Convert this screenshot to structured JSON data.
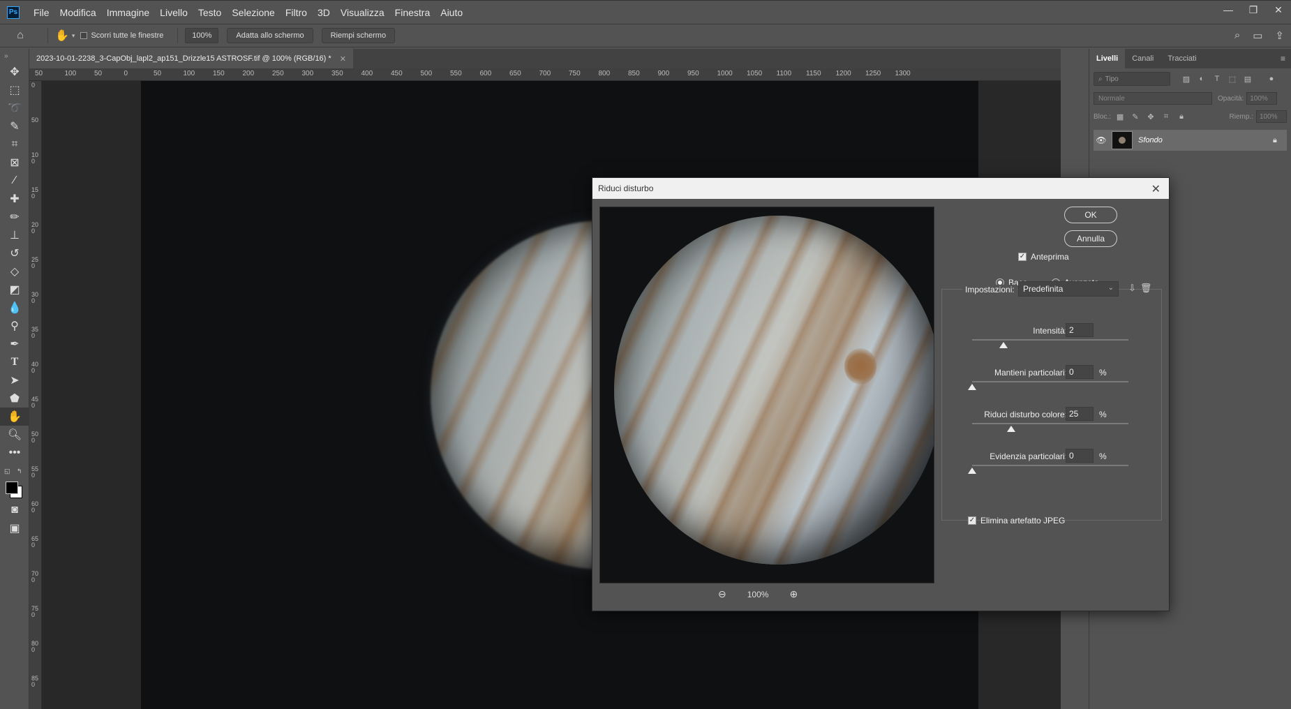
{
  "app": {
    "logo": "Ps"
  },
  "menu": [
    "File",
    "Modifica",
    "Immagine",
    "Livello",
    "Testo",
    "Selezione",
    "Filtro",
    "3D",
    "Visualizza",
    "Finestra",
    "Aiuto"
  ],
  "window_controls": [
    "—",
    "❐",
    "✕"
  ],
  "options_bar": {
    "scroll_all_label": "Scorri tutte le finestre",
    "zoom_value": "100%",
    "fit_screen_label": "Adatta allo schermo",
    "fill_screen_label": "Riempi schermo"
  },
  "document_tab": {
    "title": "2023-10-01-2238_3-CapObj_lapl2_ap151_Drizzle15 ASTROSF.tif @ 100% (RGB/16) *",
    "close": "✕"
  },
  "ruler": {
    "h_ticks": [
      "50",
      "100",
      "50",
      "0",
      "50",
      "100",
      "150",
      "200",
      "250",
      "300",
      "350",
      "400",
      "450",
      "500",
      "550",
      "600",
      "650",
      "700",
      "750",
      "800",
      "850",
      "900",
      "950",
      "1000",
      "1050",
      "1100",
      "1150",
      "1200",
      "1250",
      "1300"
    ],
    "v_ticks": [
      "0",
      "50",
      "100",
      "150",
      "200",
      "250",
      "300",
      "350",
      "400",
      "450",
      "500",
      "550",
      "600",
      "650",
      "700",
      "750",
      "800",
      "850"
    ]
  },
  "layers_panel": {
    "tabs": [
      "Livelli",
      "Canali",
      "Tracciati"
    ],
    "filter_placeholder": "Tipo",
    "blend_mode": "Normale",
    "opacity_label": "Opacità:",
    "opacity_value": "100%",
    "lock_label": "Bloc.:",
    "fill_label": "Riemp.:",
    "fill_value": "100%",
    "layer_name": "Sfondo"
  },
  "dialog": {
    "title": "Riduci disturbo",
    "ok": "OK",
    "cancel": "Annulla",
    "preview_label": "Anteprima",
    "preview_checked": true,
    "mode_base": "Base",
    "mode_advanced": "Avanzata",
    "mode_selected": "Base",
    "settings_label": "Impostazioni:",
    "settings_value": "Predefinita",
    "zoom_value": "100%",
    "params": [
      {
        "label": "Intensità:",
        "value": "2",
        "percent": "",
        "level": 0.2
      },
      {
        "label": "Mantieni particolari:",
        "value": "0",
        "percent": "%",
        "level": 0.0
      },
      {
        "label": "Riduci disturbo colore:",
        "value": "25",
        "percent": "%",
        "level": 0.25
      },
      {
        "label": "Evidenzia particolari:",
        "value": "0",
        "percent": "%",
        "level": 0.0
      }
    ],
    "jpeg_label": "Elimina artefatto JPEG",
    "jpeg_checked": true
  }
}
